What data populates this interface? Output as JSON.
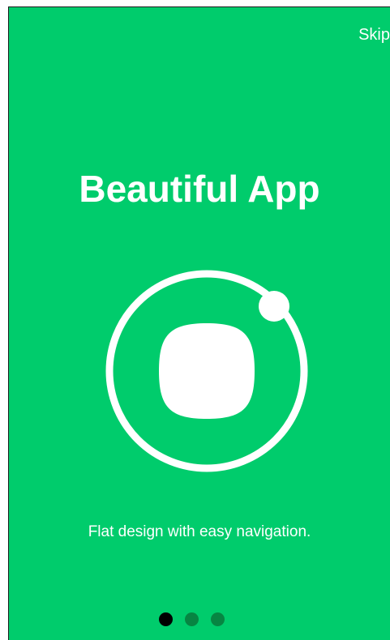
{
  "header": {
    "skip_label": "Skip"
  },
  "slide": {
    "title": "Beautiful App",
    "description": "Flat design with easy navigation.",
    "icon": "ionic-logo-icon"
  },
  "pager": {
    "total": 3,
    "active_index": 0
  },
  "colors": {
    "background": "#00cc6c",
    "foreground": "#ffffff",
    "dot_active": "#000000",
    "dot_inactive": "#078542"
  }
}
